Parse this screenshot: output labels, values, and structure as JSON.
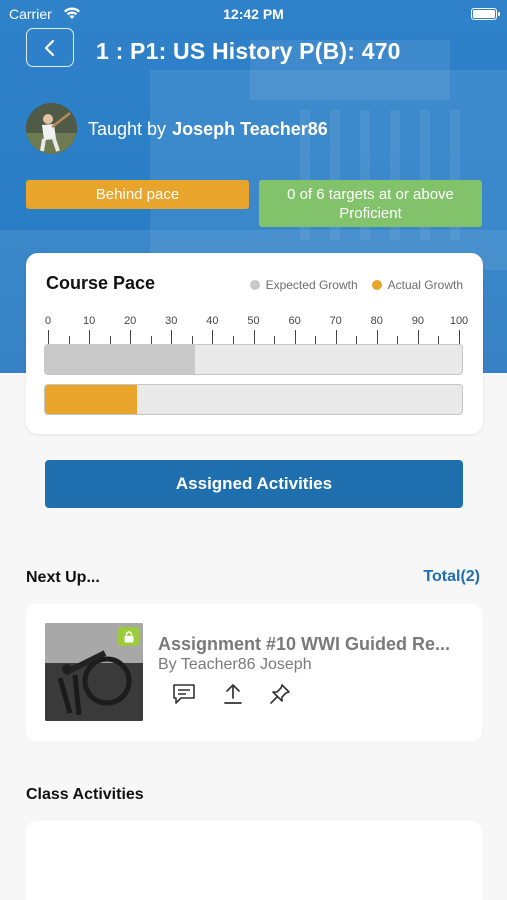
{
  "status_bar": {
    "carrier": "Carrier",
    "time": "12:42 PM"
  },
  "header": {
    "title": "1 : P1: US History P(B): 470",
    "taught_by_label": "Taught by",
    "teacher_name": "Joseph Teacher86"
  },
  "badges": {
    "pace": "Behind pace",
    "targets": "0 of 6 targets at or above Proficient"
  },
  "course_pace": {
    "title": "Course Pace",
    "legend": {
      "expected": "Expected Growth",
      "actual": "Actual Growth"
    },
    "scale_labels": [
      "0",
      "10",
      "20",
      "30",
      "40",
      "50",
      "60",
      "70",
      "80",
      "90",
      "100"
    ],
    "expected_percent": 36,
    "actual_percent": 22,
    "colors": {
      "expected": "#c9c9c9",
      "actual": "#e9a52b"
    }
  },
  "assigned_button": "Assigned Activities",
  "next_up": {
    "title": "Next Up...",
    "total": "Total(2)",
    "assignment": {
      "title": "Assignment #10 WWI Guided Re...",
      "by": "By Teacher86 Joseph",
      "actions": [
        "comment-icon",
        "upload-icon",
        "pin-icon"
      ]
    }
  },
  "class_activities": {
    "title": "Class Activities"
  },
  "colors": {
    "header_blue": "#2f82c9",
    "primary_button": "#1f6fae",
    "behind_pace": "#e9a52b",
    "targets_green": "#82c26a"
  }
}
